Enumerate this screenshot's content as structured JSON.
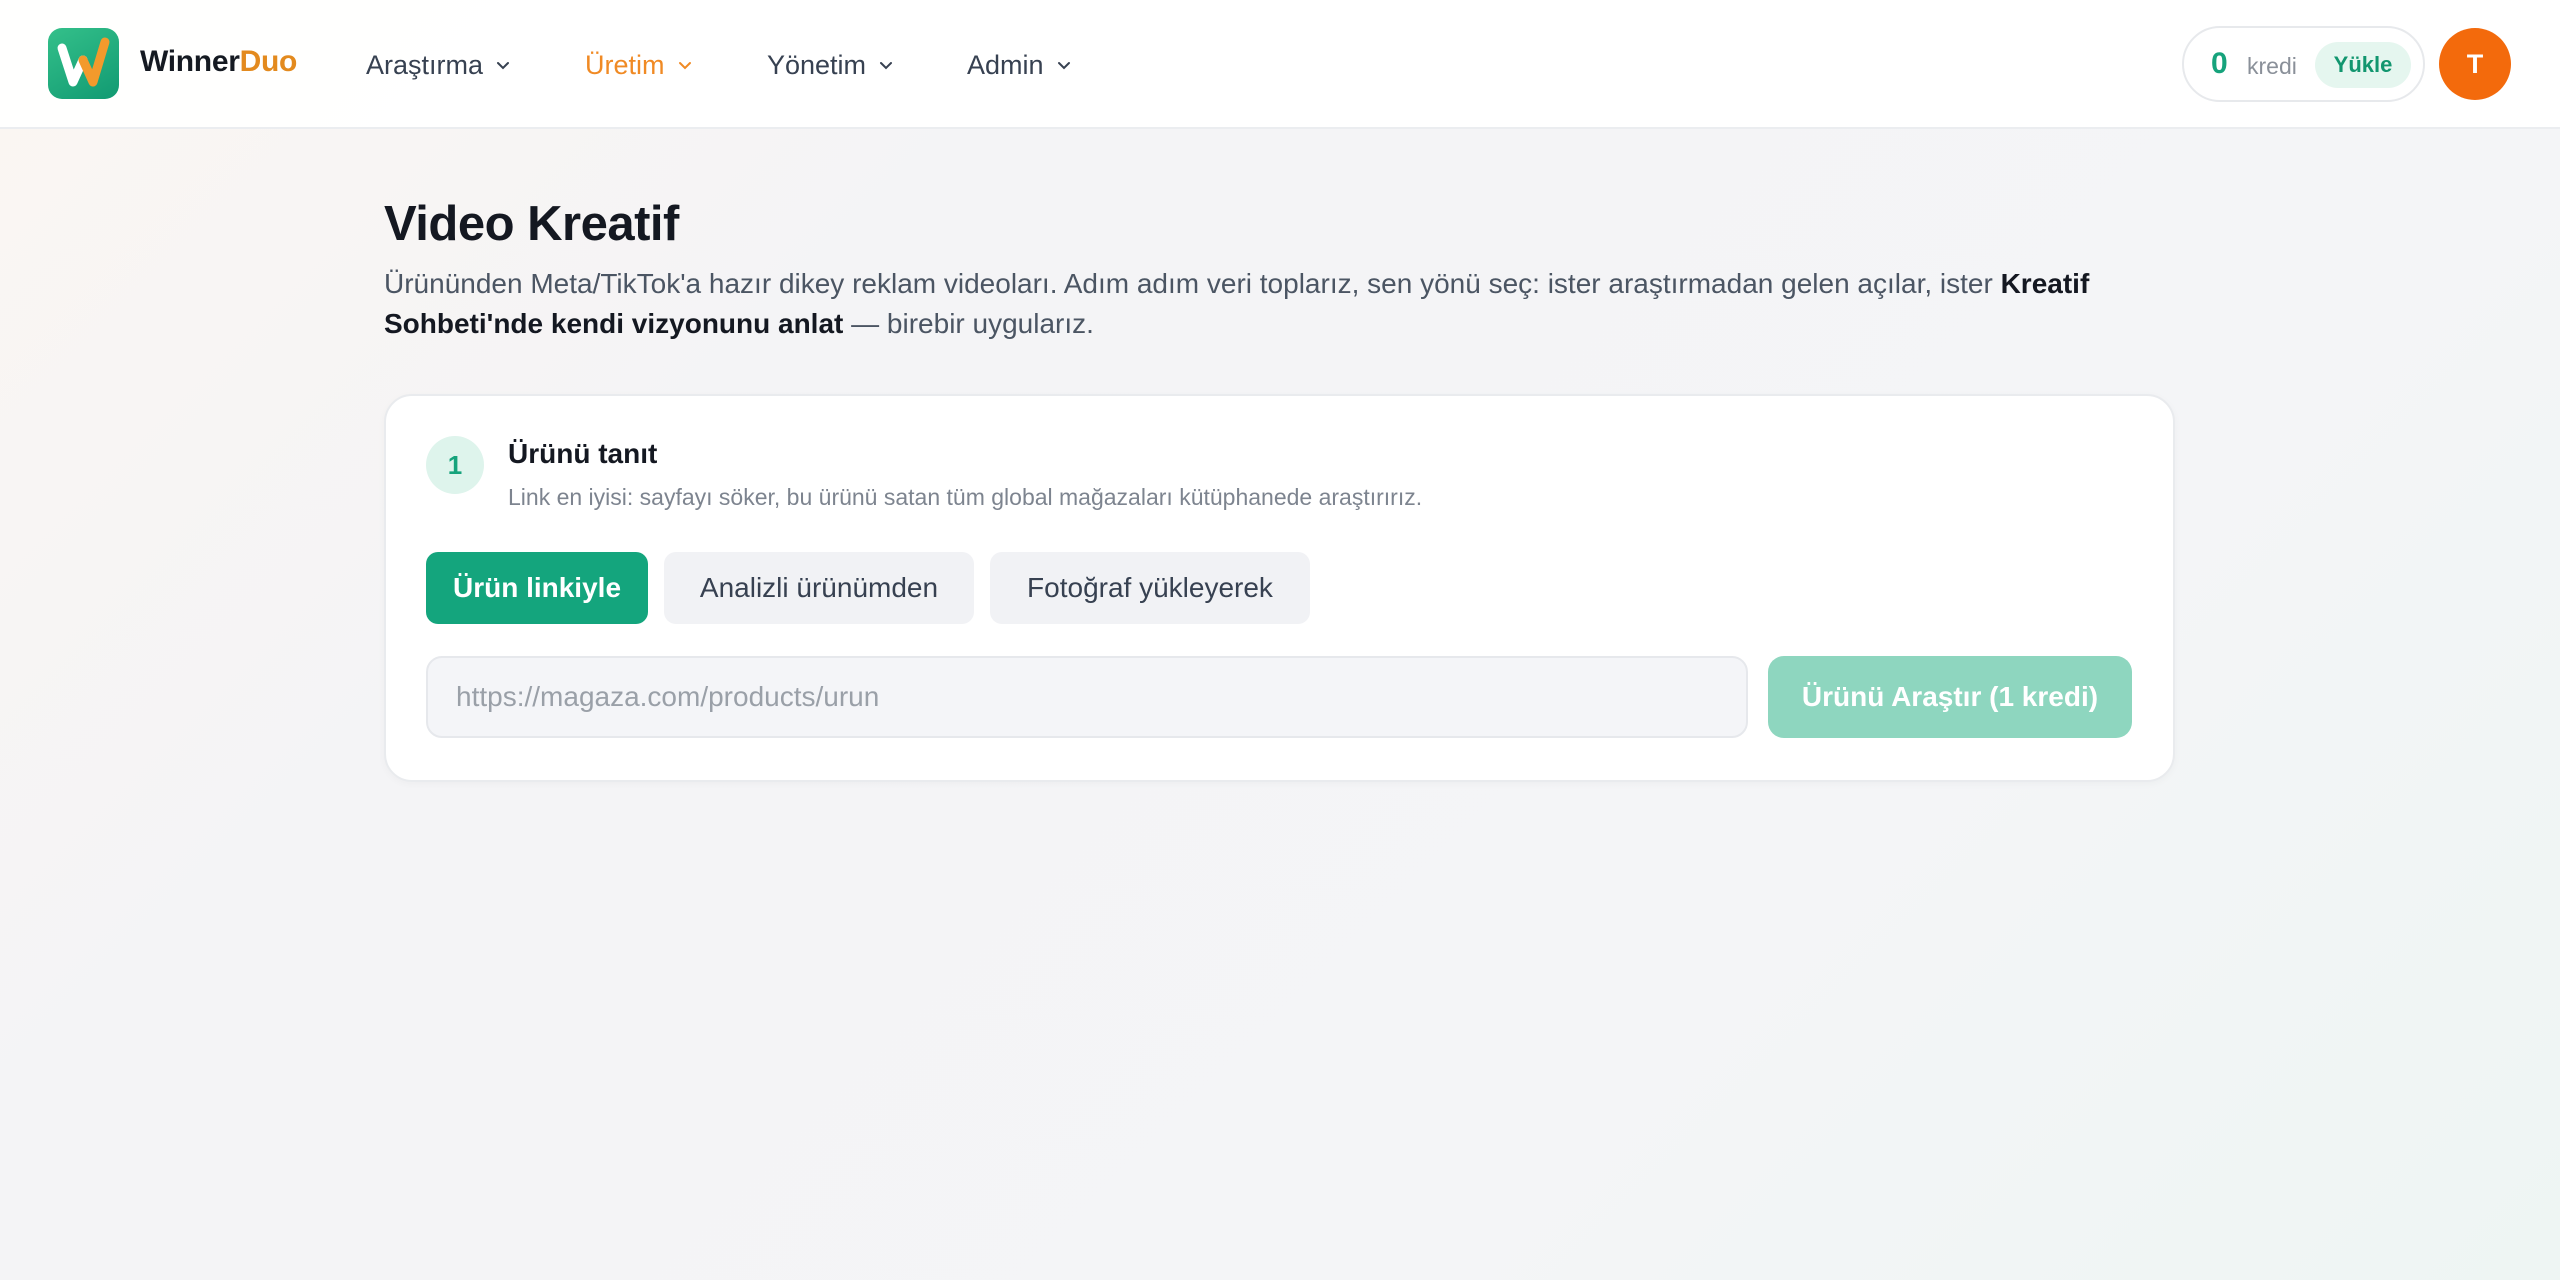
{
  "header": {
    "brand_part1": "Winner",
    "brand_part2": "Duo",
    "nav": [
      {
        "label": "Araştırma",
        "active": false
      },
      {
        "label": "Üretim",
        "active": true
      },
      {
        "label": "Yönetim",
        "active": false
      },
      {
        "label": "Admin",
        "active": false
      }
    ],
    "credits": {
      "count": "0",
      "label": "kredi",
      "load_label": "Yükle"
    },
    "avatar_initial": "T"
  },
  "main": {
    "title": "Video Kreatif",
    "description_prefix": "Ürününden Meta/TikTok'a hazır dikey reklam videoları. Adım adım veri toplarız, sen yönü seç: ister araştırmadan gelen açılar, ister ",
    "description_bold": "Kreatif Sohbeti'nde kendi vizyonunu anlat",
    "description_suffix": " — birebir uygularız.",
    "step": {
      "number": "1",
      "title": "Ürünü tanıt",
      "subtitle": "Link en iyisi: sayfayı söker, bu ürünü satan tüm global mağazaları kütüphanede araştırırız.",
      "tabs": [
        {
          "label": "Ürün linkiyle",
          "active": true
        },
        {
          "label": "Analizli ürünümden",
          "active": false
        },
        {
          "label": "Fotoğraf yükleyerek",
          "active": false
        }
      ],
      "url_input": {
        "value": "",
        "placeholder": "https://magaza.com/products/urun"
      },
      "submit_label": "Ürünü Araştır (1 kredi)"
    }
  },
  "colors": {
    "accent_green": "#14a57d",
    "accent_orange": "#f08a24",
    "avatar_orange": "#f36a0c",
    "disabled_green": "#8ed6bf"
  },
  "icons": {
    "logo": "winnerduo-logo-icon",
    "nav_chevron": "chevron-down-icon"
  }
}
